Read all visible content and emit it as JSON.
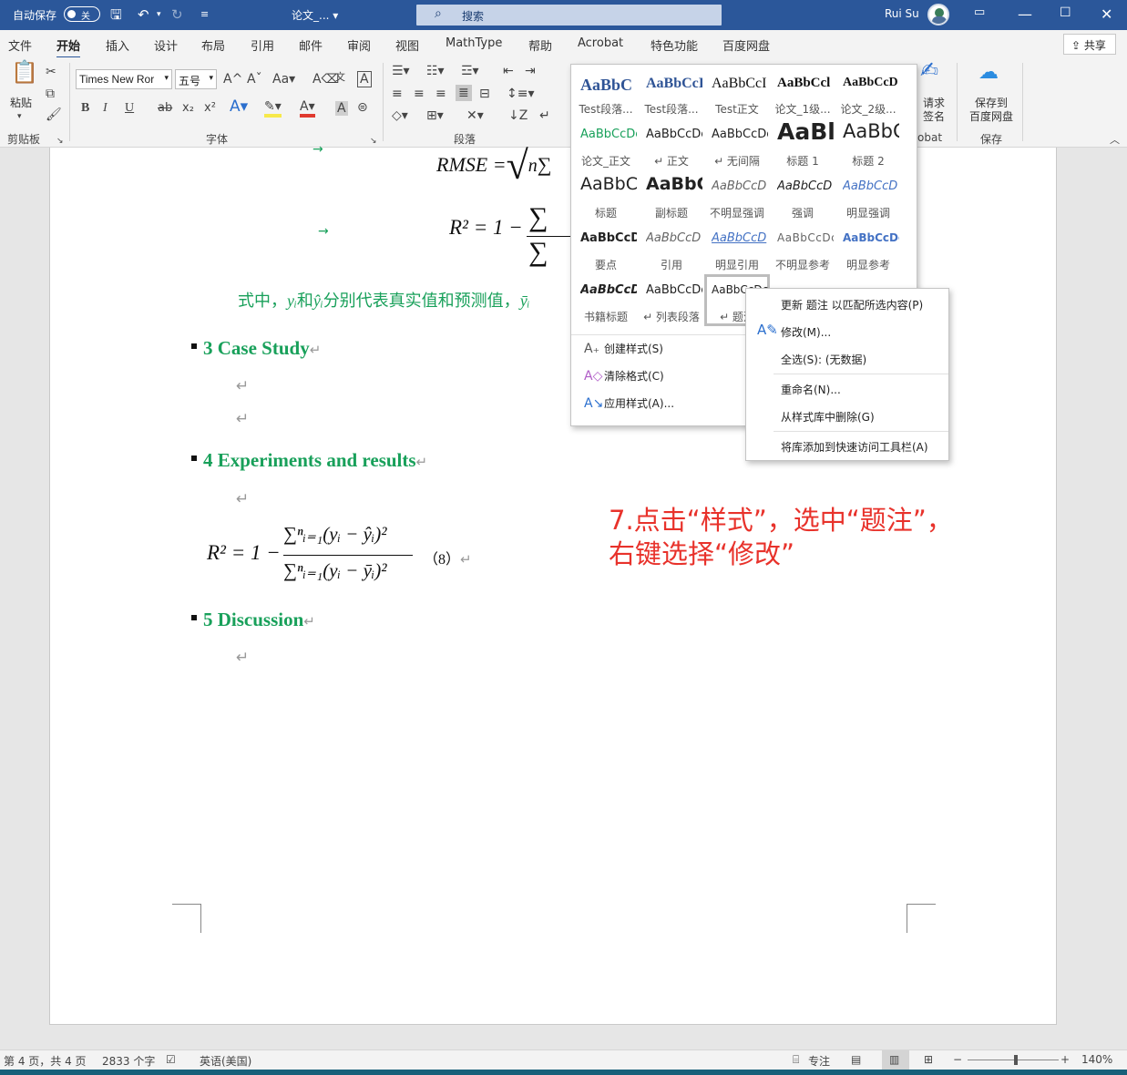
{
  "titlebar": {
    "autosave_label": "自动保存",
    "autosave_state": "关",
    "doc_title": "论文_...",
    "search_placeholder": "搜索",
    "user_name": "Rui Su"
  },
  "menu_tabs": [
    "文件",
    "开始",
    "插入",
    "设计",
    "布局",
    "引用",
    "邮件",
    "审阅",
    "视图",
    "MathType",
    "帮助",
    "Acrobat",
    "特色功能",
    "百度网盘"
  ],
  "active_tab": "开始",
  "share_label": "共享",
  "ribbon": {
    "paste_label": "粘贴",
    "clipboard_group": "剪贴板",
    "font_name": "Times New Ror",
    "font_size": "五号",
    "font_group": "字体",
    "paragraph_group": "段落",
    "sign_label_1": "请求",
    "sign_label_2": "签名",
    "acrobat_group": "obat",
    "save_label_1": "保存到",
    "save_label_2": "百度网盘",
    "save_group": "保存",
    "font_buttons": [
      "B",
      "I",
      "U",
      "ab",
      "x₂",
      "x²"
    ]
  },
  "document": {
    "eq_rmse": "RMSE =",
    "eq_r2_top": "R² = 1 −",
    "sentence_a": "式中，",
    "sentence_b": "和",
    "sentence_c": "分别代表真实值和预测值，",
    "var_y": "yᵢ",
    "var_yhat": "ŷᵢ",
    "var_ybar": "ȳᵢ",
    "heading3": "3 Case Study",
    "heading4": "4 Experiments and results",
    "heading5": "5 Discussion",
    "eq_r2_lhs": "R² = 1 −",
    "eq_num": "∑ⁿᵢ₌₁(yᵢ − ŷᵢ)²",
    "eq_den": "∑ⁿᵢ₌₁(yᵢ − ȳᵢ)²",
    "eq_number": "（8）",
    "return_mark": "↵"
  },
  "annotation": {
    "line1": "7.点击“样式”，选中“题注”，",
    "line2": "右键选择“修改”"
  },
  "styles_gallery": [
    {
      "preview": "AaBbC",
      "name": "Test段落..."
    },
    {
      "preview": "AaBbCcI",
      "name": "Test段落..."
    },
    {
      "preview": "AaBbCcI",
      "name": "Test正文"
    },
    {
      "preview": "AaBbCcl",
      "name": "论文_1级..."
    },
    {
      "preview": "AaBbCcD",
      "name": "论文_2级..."
    },
    {
      "preview": "AaBbCcDc",
      "name": "论文_正文"
    },
    {
      "preview": "AaBbCcDc",
      "name": "↵ 正文"
    },
    {
      "preview": "AaBbCcDc",
      "name": "↵ 无间隔"
    },
    {
      "preview": "AaBl",
      "name": "标题 1"
    },
    {
      "preview": "AaBbC",
      "name": "标题 2"
    },
    {
      "preview": "AaBbC",
      "name": "标题"
    },
    {
      "preview": "AaBbC",
      "name": "副标题"
    },
    {
      "preview": "AaBbCcD",
      "name": "不明显强调"
    },
    {
      "preview": "AaBbCcD",
      "name": "强调"
    },
    {
      "preview": "AaBbCcD",
      "name": "明显强调"
    },
    {
      "preview": "AaBbCcD",
      "name": "要点"
    },
    {
      "preview": "AaBbCcD",
      "name": "引用"
    },
    {
      "preview": "AaBbCcD",
      "name": "明显引用"
    },
    {
      "preview": "AaBbCcDc",
      "name": "不明显参考"
    },
    {
      "preview": "AaBbCcDc",
      "name": "明显参考"
    },
    {
      "preview": "AaBbCcD",
      "name": "书籍标题"
    },
    {
      "preview": "AaBbCcDc",
      "name": "↵ 列表段落"
    },
    {
      "preview": "AaBbCcDc",
      "name": "↵ 题注"
    }
  ],
  "gallery_actions": [
    "创建样式(S)",
    "清除格式(C)",
    "应用样式(A)..."
  ],
  "context_menu": [
    "更新 题注 以匹配所选内容(P)",
    "修改(M)...",
    "全选(S): (无数据)",
    "重命名(N)...",
    "从样式库中删除(G)",
    "将库添加到快速访问工具栏(A)"
  ],
  "statusbar": {
    "page": "第 4 页，共 4 页",
    "words": "2833 个字",
    "language": "英语(美国)",
    "focus": "专注",
    "zoom": "140%"
  },
  "colors": {
    "titlebar": "#2b579a",
    "heading_green": "#18a05a",
    "annotation_red": "#e8322b"
  }
}
